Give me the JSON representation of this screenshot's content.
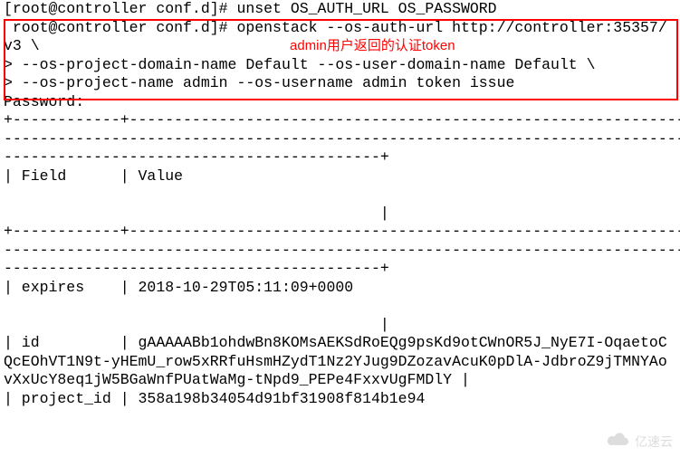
{
  "lines": {
    "l1": "[root@controller conf.d]# unset OS_AUTH_URL OS_PASSWORD",
    "l2": " root@controller conf.d]# openstack --os-auth-url http://controller:35357/",
    "l3": "v3 \\",
    "l4": "> --os-project-domain-name Default --os-user-domain-name Default \\",
    "l5": "> --os-project-name admin --os-username admin token issue",
    "l6": "Password:",
    "l7": "+------------+----------------------------------------------------------------",
    "l8": "-------------------------------------------------------------------------------",
    "l9": "------------------------------------------+",
    "l10": "| Field      | Value                                                          ",
    "l11": "                                                                               ",
    "l12": "                                          |",
    "l13": "+------------+----------------------------------------------------------------",
    "l14": "-------------------------------------------------------------------------------",
    "l15": "------------------------------------------+",
    "l16": "| expires    | 2018-10-29T05:11:09+0000                                       ",
    "l17": "                                                                               ",
    "l18": "                                          |",
    "l19": "| id         | gAAAAABb1ohdwBn8KOMsAEKSdRoEQg9psKd9otCWnOR5J_NyE7I-OqaetoC",
    "l20": "QcEOhVT1N9t-yHEmU_row5xRRfuHsmHZydT1Nz2YJug9DZozavAcuK0pDlA-JdbroZ9jTMNYAo",
    "l21": "vXxUcY8eq1jW5BGaWnfPUatWaMg-tNpd9_PEPe4FxxvUgFMDlY |",
    "l22": "| project_id | 358a198b34054d91bf31908f814b1e94                               "
  },
  "annotation": "admin用户返回的认证token",
  "watermark": "亿速云",
  "table_fields": {
    "header_field": "Field",
    "header_value": "Value",
    "expires_key": "expires",
    "expires_val": "2018-10-29T05:11:09+0000",
    "id_key": "id",
    "id_val": "gAAAAABb1ohdwBn8KOMsAEKSdRoEQg9psKd9otCWnOR5J_NyE7I-OqaetoCQcEOhVT1N9t-yHEmU_row5xRRfuHsmHZydT1Nz2YJug9DZozavAcuK0pDlA-JdbroZ9jTMNYAovXxUcY8eq1jW5BGaWnfPUatWaMg-tNpd9_PEPe4FxxvUgFMDlY",
    "project_id_key": "project_id",
    "project_id_val": "358a198b34054d91bf31908f814b1e94"
  },
  "commands": {
    "unset": "unset OS_AUTH_URL OS_PASSWORD",
    "openstack": "openstack --os-auth-url http://controller:35357/v3 --os-project-domain-name Default --os-user-domain-name Default --os-project-name admin --os-username admin token issue"
  }
}
